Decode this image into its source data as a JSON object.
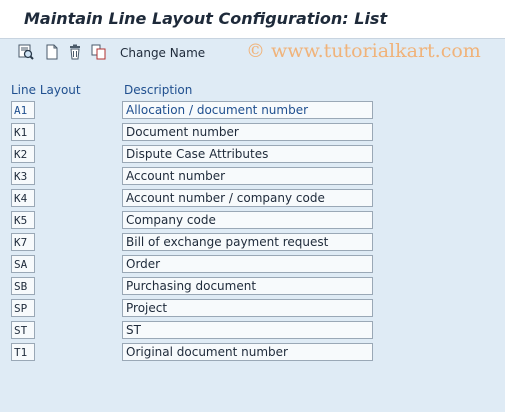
{
  "window": {
    "title": "Maintain Line Layout Configuration: List"
  },
  "toolbar": {
    "change_name_label": "Change Name"
  },
  "watermark": "© www.tutorialkart.com",
  "table": {
    "headers": {
      "code": "Line Layout",
      "description": "Description"
    },
    "rows": [
      {
        "code": "A1",
        "description": "Allocation / document number"
      },
      {
        "code": "K1",
        "description": "Document number"
      },
      {
        "code": "K2",
        "description": "Dispute Case Attributes"
      },
      {
        "code": "K3",
        "description": "Account number"
      },
      {
        "code": "K4",
        "description": "Account number / company code"
      },
      {
        "code": "K5",
        "description": "Company code"
      },
      {
        "code": "K7",
        "description": "Bill of exchange payment request"
      },
      {
        "code": "SA",
        "description": "Order"
      },
      {
        "code": "SB",
        "description": "Purchasing document"
      },
      {
        "code": "SP",
        "description": "Project"
      },
      {
        "code": "ST",
        "description": "ST"
      },
      {
        "code": "T1",
        "description": "Original document number"
      }
    ]
  }
}
